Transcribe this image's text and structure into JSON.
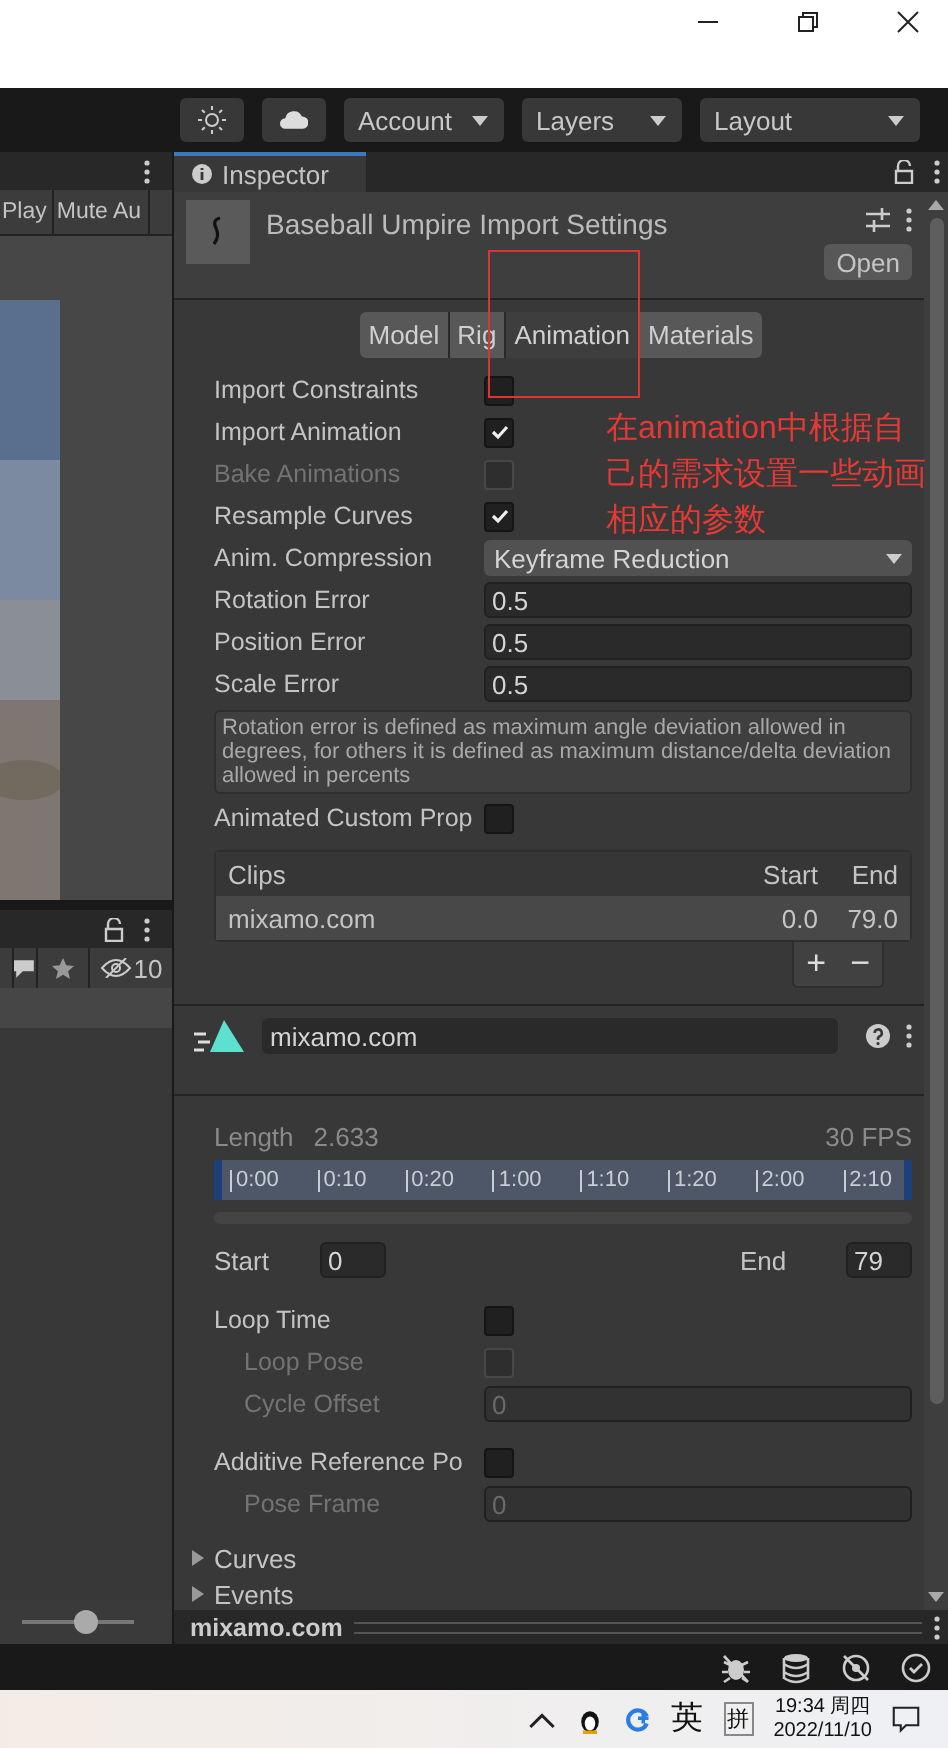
{
  "toolbar": {
    "dropdowns": [
      "Account",
      "Layers",
      "Layout"
    ]
  },
  "left_panel": {
    "toolbar_buttons": [
      "Play",
      "Mute Au"
    ],
    "hidden_count": "10",
    "zoom_slider": {
      "level": 0.6
    }
  },
  "inspector": {
    "tab": "Inspector",
    "title": "Baseball Umpire Import Settings",
    "open_button": "Open",
    "tabs": [
      {
        "label": "Model",
        "selected": false
      },
      {
        "label": "Rig",
        "selected": false
      },
      {
        "label": "Animation",
        "selected": true
      },
      {
        "label": "Materials",
        "selected": false
      }
    ],
    "annotation": "在animation中根据自己的需求设置一些动画相应的参数",
    "properties": [
      {
        "kind": "checkbox",
        "label": "Import Constraints",
        "checked": false,
        "disabled": false
      },
      {
        "kind": "checkbox",
        "label": "Import Animation",
        "checked": true,
        "disabled": false
      },
      {
        "kind": "checkbox",
        "label": "Bake Animations",
        "checked": false,
        "disabled": true
      },
      {
        "kind": "checkbox",
        "label": "Resample Curves",
        "checked": true,
        "disabled": false
      },
      {
        "kind": "dropdown",
        "label": "Anim. Compression",
        "value": "Keyframe Reduction"
      },
      {
        "kind": "number",
        "label": "Rotation Error",
        "value": "0.5",
        "disabled": false
      },
      {
        "kind": "number",
        "label": "Position Error",
        "value": "0.5",
        "disabled": false
      },
      {
        "kind": "number",
        "label": "Scale Error",
        "value": "0.5",
        "disabled": false
      },
      {
        "kind": "help",
        "text": "Rotation error is defined as maximum angle deviation allowed in degrees, for others it is defined as maximum distance/delta deviation allowed in percents"
      },
      {
        "kind": "checkbox",
        "label": "Animated Custom Prop",
        "checked": false,
        "disabled": false
      }
    ],
    "clips": {
      "columns": [
        "Clips",
        "Start",
        "End"
      ],
      "rows": [
        {
          "name": "mixamo.com",
          "start": "0.0",
          "end": "79.0"
        }
      ],
      "buttons": [
        "+",
        "−"
      ]
    },
    "clip": {
      "name": "mixamo.com",
      "length_label": "Length",
      "length": "2.633",
      "fps": "30 FPS",
      "ticks": [
        "0:00",
        "0:10",
        "0:20",
        "1:00",
        "1:10",
        "1:20",
        "2:00",
        "2:10"
      ],
      "start_label": "Start",
      "start": "0",
      "end_label": "End",
      "end": "79"
    },
    "clip_properties": [
      {
        "kind": "checkbox",
        "label": "Loop Time",
        "checked": false,
        "disabled": false,
        "indent": false
      },
      {
        "kind": "checkbox",
        "label": "Loop Pose",
        "checked": false,
        "disabled": true,
        "indent": true
      },
      {
        "kind": "number",
        "label": "Cycle Offset",
        "value": "0",
        "disabled": true,
        "indent": true
      },
      {
        "kind": "checkbox",
        "label": "Additive Reference Po",
        "checked": false,
        "disabled": false,
        "indent": false
      },
      {
        "kind": "number",
        "label": "Pose Frame",
        "value": "0",
        "disabled": true,
        "indent": true
      }
    ],
    "foldouts": [
      {
        "label": "Curves",
        "expanded": false
      },
      {
        "label": "Events",
        "expanded": false
      }
    ],
    "preview_title": "mixamo.com"
  },
  "taskbar": {
    "ime": "英",
    "ime_mode": "拼",
    "time": "19:34 周四",
    "date": "2022/11/10"
  }
}
